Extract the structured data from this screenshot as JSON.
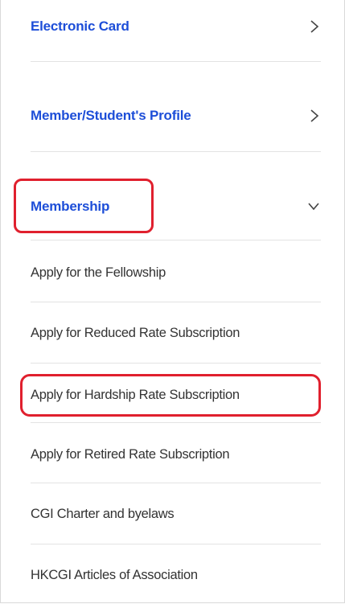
{
  "menu": {
    "items": [
      {
        "label": "Electronic Card",
        "level": "primary",
        "chevron": "chevron-right-icon"
      },
      {
        "label": "Member/Student's Profile",
        "level": "primary",
        "chevron": "chevron-right-icon"
      },
      {
        "label": "Membership",
        "level": "primary",
        "chevron": "chevron-down-icon",
        "expanded": true
      },
      {
        "label": "Apply for the Fellowship",
        "level": "sub"
      },
      {
        "label": "Apply for Reduced Rate Subscription",
        "level": "sub"
      },
      {
        "label": "Apply for Hardship Rate Subscription",
        "level": "sub"
      },
      {
        "label": "Apply for Retired Rate Subscription",
        "level": "sub"
      },
      {
        "label": "CGI Charter and byelaws",
        "level": "sub"
      },
      {
        "label": "HKCGI Articles of Association",
        "level": "sub"
      }
    ]
  },
  "colors": {
    "primary_text": "#1d4ed8",
    "sub_text": "#333333",
    "highlight": "#e0202e",
    "divider": "#e3e3e3"
  }
}
